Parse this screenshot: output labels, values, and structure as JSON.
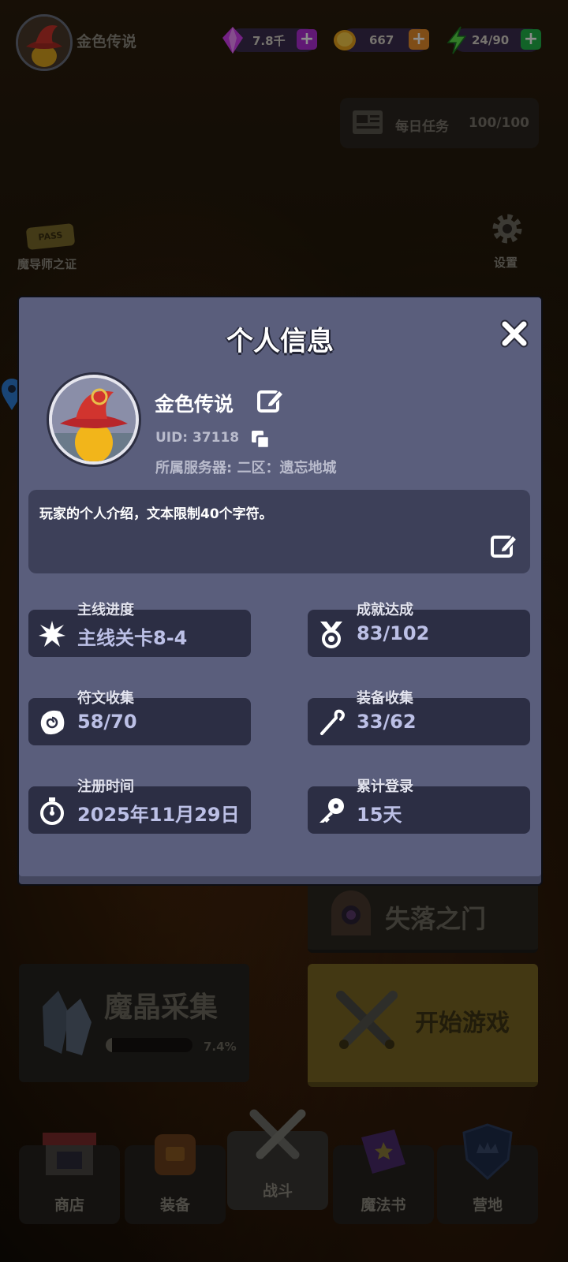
{
  "topbar": {
    "player_name": "金色传说",
    "gems": {
      "amount": "7.8千",
      "accent": "#c23ce6"
    },
    "gold": {
      "amount": "667",
      "accent": "#f0a23a"
    },
    "energy": {
      "amount": "24/90",
      "accent": "#27c453"
    },
    "plus": "+"
  },
  "daily_task": {
    "label": "每日任务",
    "count": "100/100"
  },
  "pass": {
    "badge": "PASS",
    "label": "魔导师之证"
  },
  "settings": {
    "label": "设置"
  },
  "modal": {
    "title": "个人信息",
    "name": "金色传说",
    "uid": "UID: 37118",
    "server": "所属服务器: 二区：遗忘地城",
    "bio": "玩家的个人介绍，文本限制40个字符。",
    "stats": [
      {
        "label": "主线进度",
        "value": "主线关卡8-4",
        "icon": "starburst-icon"
      },
      {
        "label": "成就达成",
        "value": "83/102",
        "icon": "medal-icon"
      },
      {
        "label": "符文收集",
        "value": "58/70",
        "icon": "rune-stone-icon"
      },
      {
        "label": "装备收集",
        "value": "33/62",
        "icon": "staff-icon"
      },
      {
        "label": "注册时间",
        "value": "2025年11月29日",
        "icon": "stopwatch-icon"
      },
      {
        "label": "累计登录",
        "value": "15天",
        "icon": "key-icon"
      }
    ]
  },
  "menu": {
    "lost_door": "失落之门",
    "crystal_collect": {
      "label": "魔晶采集",
      "progress_text": "7.4%",
      "progress": 0.074
    },
    "start_game": "开始游戏"
  },
  "nav": [
    {
      "label": "商店",
      "icon": "shop-icon"
    },
    {
      "label": "装备",
      "icon": "backpack-icon"
    },
    {
      "label": "战斗",
      "icon": "crossed-swords-icon"
    },
    {
      "label": "魔法书",
      "icon": "spellbook-icon"
    },
    {
      "label": "营地",
      "icon": "shield-crown-icon"
    }
  ]
}
